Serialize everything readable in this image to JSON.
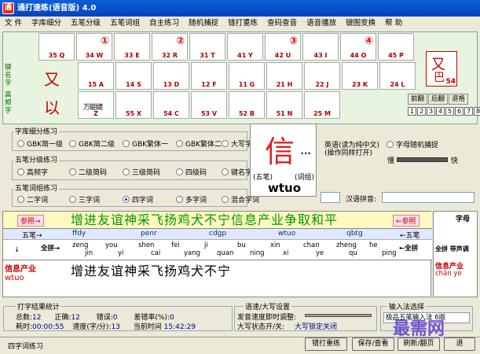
{
  "title": "通打速练(语音版) 4.0",
  "menu": [
    "文 件",
    "字库细分",
    "五笔分级",
    "五笔词组",
    "自主练习",
    "随机捕捉",
    "错打重练",
    "查码查音",
    "语音播放",
    "键图变换",
    "帮 助"
  ],
  "keys_row1": [
    {
      "code": "35 Q",
      "num": ""
    },
    {
      "code": "34 W",
      "num": "①"
    },
    {
      "code": "33 E",
      "num": ""
    },
    {
      "code": "32 R",
      "num": "②"
    },
    {
      "code": "31 T",
      "num": ""
    },
    {
      "code": "41 Y",
      "num": ""
    },
    {
      "code": "42 U",
      "num": "③"
    },
    {
      "code": "43 I",
      "num": ""
    },
    {
      "code": "44 O",
      "num": "④"
    },
    {
      "code": "45 P",
      "num": ""
    }
  ],
  "keys_row2": [
    {
      "code": "15 A"
    },
    {
      "code": "14 S"
    },
    {
      "code": "13 D"
    },
    {
      "code": "12 F"
    },
    {
      "code": "11 G"
    },
    {
      "code": "21 H"
    },
    {
      "code": "22 J"
    },
    {
      "code": "23 K"
    },
    {
      "code": "24 L"
    }
  ],
  "keys_row3": [
    {
      "code": "Z"
    },
    {
      "code": "55 X"
    },
    {
      "code": "54 C"
    },
    {
      "code": "53 V"
    },
    {
      "code": "52 B"
    },
    {
      "code": "51 N"
    },
    {
      "code": "25 M"
    }
  ],
  "z_key_label": "万能键",
  "side_label_1": "键名字",
  "side_label_2": "高频字",
  "char_you": "又",
  "char_yi": "以",
  "you_box": {
    "a": "又",
    "b": "巴",
    "c": "54"
  },
  "nav_buttons": [
    "前翻",
    "后翻",
    "退格"
  ],
  "num_buttons": [
    "1",
    "2",
    "3",
    "4",
    "5",
    "6",
    "7",
    "8"
  ],
  "grp1": {
    "title": "字库细分练习",
    "options": [
      "GBK简一级",
      "GBK简二级",
      "GBK繁体一",
      "GBK繁体二",
      "大写字母"
    ],
    "selected": -1
  },
  "grp1_right": {
    "opt_a": "英语(读为纯中文)",
    "opt_a2": "(操作同样打开)",
    "opt_b": "字母随机捕捉",
    "slow": "慢",
    "fast": "快"
  },
  "grp2": {
    "title": "五笔分级练习",
    "options": [
      "高频字",
      "二级简码",
      "三级简码",
      "四级码",
      "键名字"
    ]
  },
  "grp3": {
    "title": "五笔词组练习",
    "options": [
      "二字词",
      "三字词",
      "四字词",
      "多字词",
      "混合字词"
    ],
    "selected": 2
  },
  "pinyin_label": "汉语拼音:",
  "popup": {
    "char": "信",
    "dots": "...",
    "left": "(五笔)",
    "right": "(词组)",
    "code": "wtuo"
  },
  "typing": {
    "prompt_left": "参照→",
    "prompt_right": "←参照",
    "target_text": "增进友谊神采飞扬鸡犬不宁信息产业争取和平",
    "wubi_left": "五笔→",
    "wubi_right": "←五笔",
    "fullpin_left": "全拼→",
    "fullpin_right": "←全拼",
    "down_arrow": "↓",
    "codes": [
      "ffdy",
      "penr",
      "cdgp",
      "wtuo",
      "qbtg"
    ],
    "pinyin": [
      [
        "zeng",
        "jin"
      ],
      [
        "you",
        "yi"
      ],
      [
        "shen",
        "cai"
      ],
      [
        "fei",
        "yang"
      ],
      [
        "ji",
        "quan"
      ],
      [
        "bu",
        "ning"
      ],
      [
        "xin",
        "xi"
      ],
      [
        "chan",
        "ye"
      ],
      [
        "zheng",
        "qu"
      ],
      [
        "he",
        "ping"
      ]
    ],
    "input_text": "增进友谊神采飞扬鸡犬不宁",
    "red_info": "信息产业",
    "red_code": "wtuo",
    "right_panel_a": "字母",
    "right_panel_b": "全拼 带声调",
    "right_red": "信息产业",
    "right_pin": "chǎn yè"
  },
  "stats": {
    "title": "打字结果统计",
    "total_l": "总数:",
    "total": "12",
    "correct_l": "正确:",
    "correct": "12",
    "err_l": "错误:",
    "err": "0",
    "rate_l": "差错率(%):",
    "rate": "0",
    "time_l": "耗时:",
    "time": "00:00:55",
    "speed_l": "速度(字/分):",
    "speed": "13",
    "now_l": "当前时间",
    "now": "15:42:29"
  },
  "speech": {
    "title": "语速/大写设置",
    "line1": "发音速度即时调整:",
    "line2": "大写状态开/关:",
    "state": "大写锁定关闭"
  },
  "input": {
    "title": "输入法选择",
    "value": "极品五笔输入法 6版"
  },
  "buttons": {
    "retry": "错打重练",
    "save": "保存/查看",
    "refresh": "刷新/翻页",
    "exit": "退"
  },
  "status": "四字词练习",
  "watermark": "最需网"
}
